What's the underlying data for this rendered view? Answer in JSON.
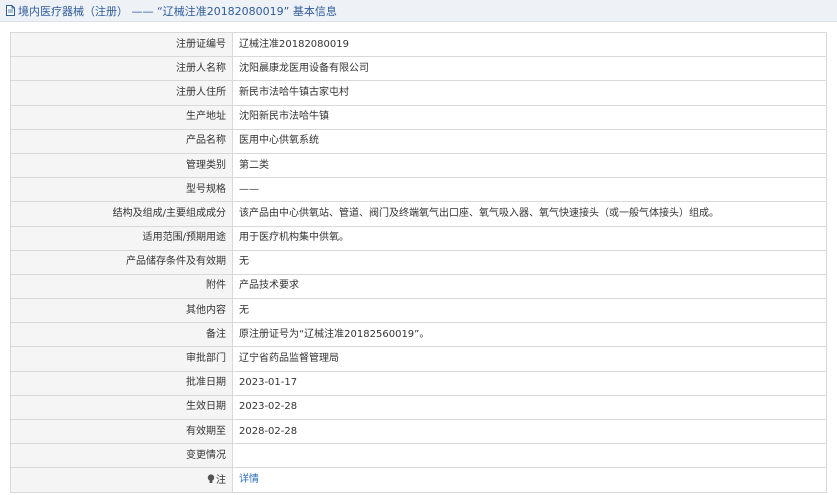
{
  "header": {
    "title": "境内医疗器械（注册） —— “辽械注准20182080019” 基本信息"
  },
  "rows": [
    {
      "label": "注册证编号",
      "value": "辽械注准20182080019"
    },
    {
      "label": "注册人名称",
      "value": "沈阳晨康龙医用设备有限公司"
    },
    {
      "label": "注册人住所",
      "value": "新民市法哈牛镇古家屯村"
    },
    {
      "label": "生产地址",
      "value": "沈阳新民市法哈牛镇"
    },
    {
      "label": "产品名称",
      "value": "医用中心供氧系统"
    },
    {
      "label": "管理类别",
      "value": "第二类"
    },
    {
      "label": "型号规格",
      "value": "——"
    },
    {
      "label": "结构及组成/主要组成成分",
      "value": "该产品由中心供氧站、管道、阀门及终端氧气出口座、氧气吸入器、氧气快速接头（或一般气体接头）组成。"
    },
    {
      "label": "适用范围/预期用途",
      "value": "用于医疗机构集中供氧。"
    },
    {
      "label": "产品储存条件及有效期",
      "value": "无"
    },
    {
      "label": "附件",
      "value": "产品技术要求"
    },
    {
      "label": "其他内容",
      "value": "无"
    },
    {
      "label": "备注",
      "value": "原注册证号为“辽械注准20182560019”。"
    },
    {
      "label": "审批部门",
      "value": "辽宁省药品监督管理局"
    },
    {
      "label": "批准日期",
      "value": "2023-01-17"
    },
    {
      "label": "生效日期",
      "value": "2023-02-28"
    },
    {
      "label": "有效期至",
      "value": "2028-02-28"
    },
    {
      "label": "变更情况",
      "value": ""
    }
  ],
  "note_row": {
    "label": "注",
    "link": "详情",
    "icon": "lightbulb-icon"
  },
  "colors": {
    "header_bg": "#eef1f6",
    "header_text": "#2f5d9c",
    "label_bg": "#f5f5f5",
    "border": "#d9d9d9",
    "link": "#2f6fb6"
  }
}
